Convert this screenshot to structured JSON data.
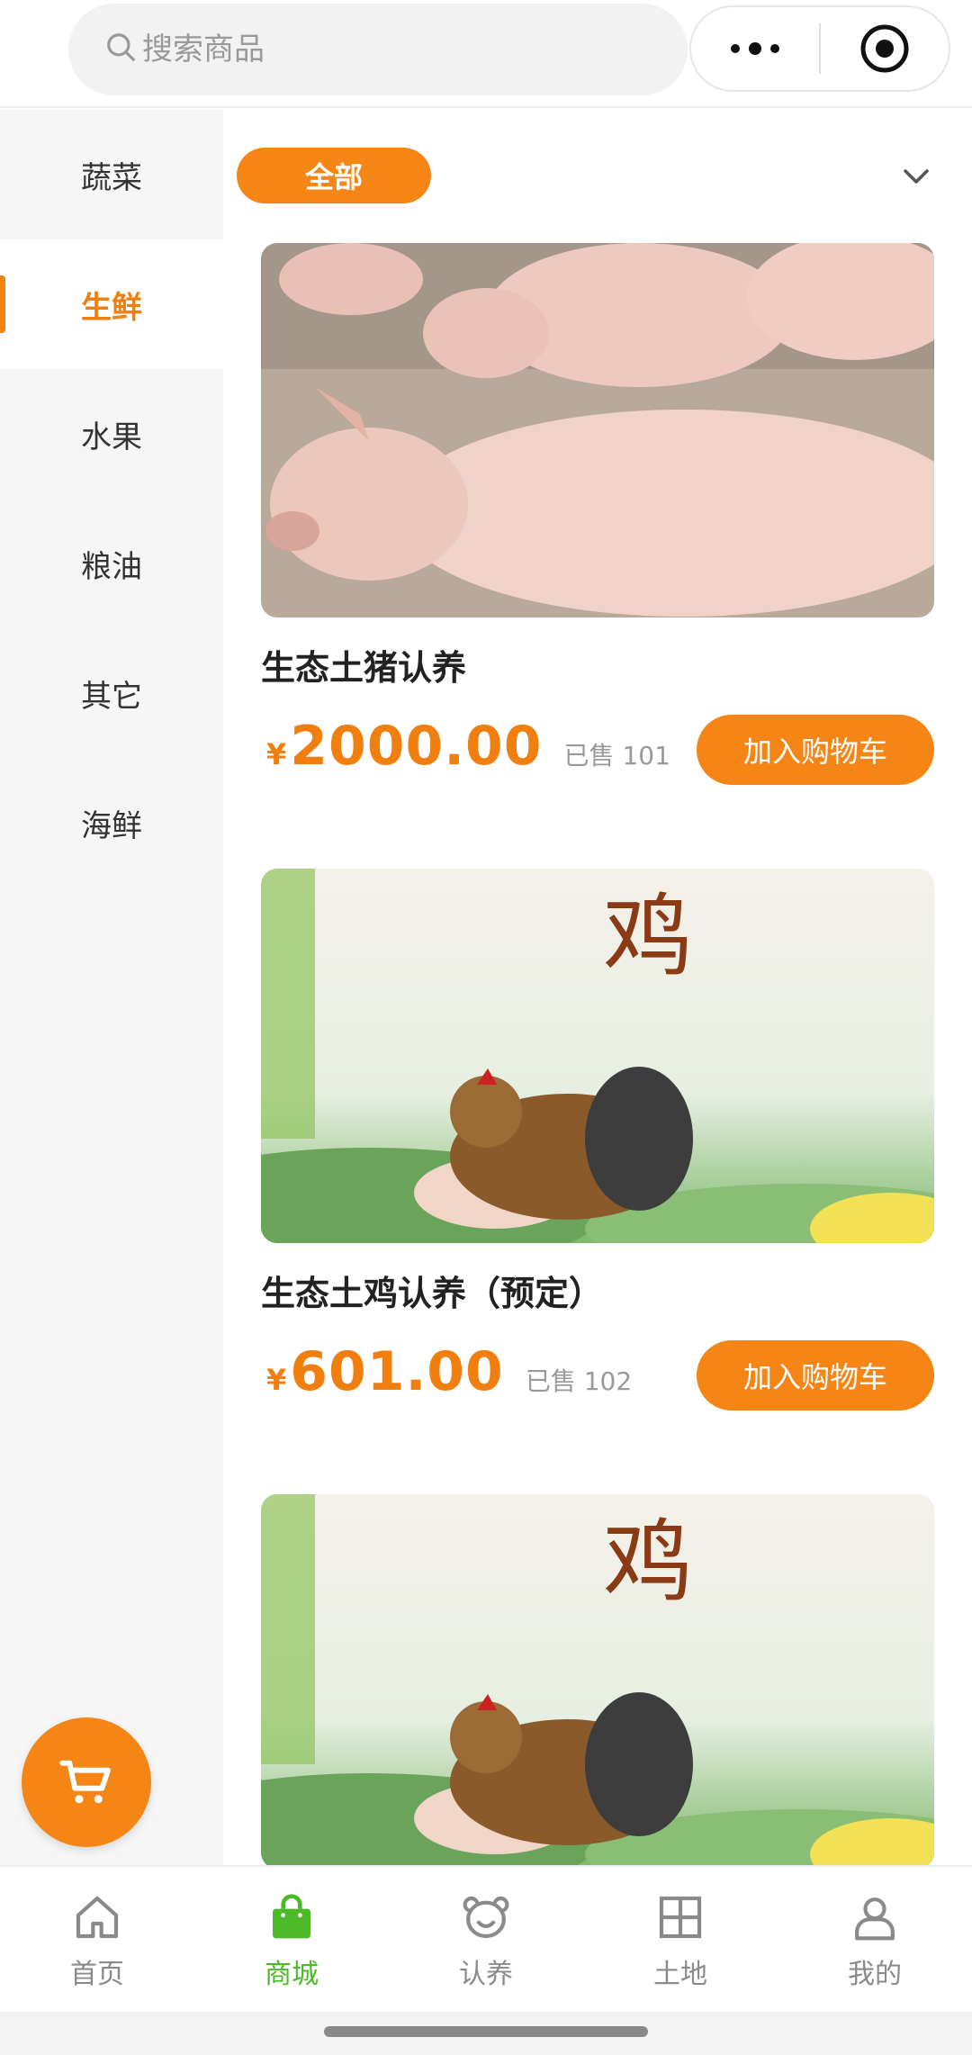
{
  "search": {
    "placeholder": "搜索商品"
  },
  "sidebar": {
    "items": [
      {
        "label": "蔬菜",
        "active": false
      },
      {
        "label": "生鲜",
        "active": true
      },
      {
        "label": "水果",
        "active": false
      },
      {
        "label": "粮油",
        "active": false
      },
      {
        "label": "其它",
        "active": false
      },
      {
        "label": "海鲜",
        "active": false
      }
    ]
  },
  "filter": {
    "label": "全部"
  },
  "currency": "¥",
  "products": [
    {
      "title": "生态土猪认养",
      "price": "2000.00",
      "sold": "已售 101",
      "button": "加入购物车"
    },
    {
      "title": "生态土鸡认养（预定）",
      "price": "601.00",
      "sold": "已售 102",
      "button": "加入购物车"
    },
    {
      "title": "",
      "price": "",
      "sold": "",
      "button": ""
    }
  ],
  "tabbar": {
    "items": [
      {
        "label": "首页",
        "icon": "home-icon",
        "active": false
      },
      {
        "label": "商城",
        "icon": "shopping-bag-icon",
        "active": true
      },
      {
        "label": "认养",
        "icon": "bear-face-icon",
        "active": false
      },
      {
        "label": "土地",
        "icon": "land-grid-icon",
        "active": false
      },
      {
        "label": "我的",
        "icon": "user-icon",
        "active": false
      }
    ]
  },
  "colors": {
    "accent": "#f58514",
    "active_tab": "#4cb929",
    "price": "#f07f10"
  }
}
